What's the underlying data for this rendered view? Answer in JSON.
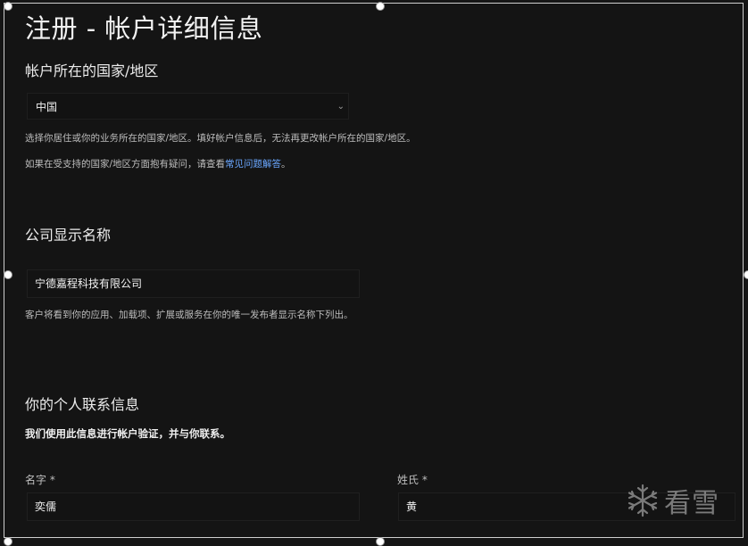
{
  "page": {
    "title": "注册 - 帐户详细信息"
  },
  "country_section": {
    "heading": "帐户所在的国家/地区",
    "selected": "中国",
    "help1": "选择你居住或你的业务所在的国家/地区。填好帐户信息后，无法再更改帐户所在的国家/地区。",
    "help2_prefix": "如果在受支持的国家/地区方面抱有疑问，请查看",
    "help2_link": "常见问题解答",
    "help2_suffix": "。"
  },
  "company_section": {
    "heading": "公司显示名称",
    "value": "宁德嘉程科技有限公司",
    "help": "客户将看到你的应用、加载项、扩展或服务在你的唯一发布者显示名称下列出。"
  },
  "contact_section": {
    "heading": "你的个人联系信息",
    "note": "我们使用此信息进行帐户验证，并与你联系。",
    "first_name_label": "名字 *",
    "first_name_value": "奕儒",
    "last_name_label": "姓氏 *",
    "last_name_value": "黄"
  },
  "watermark": {
    "text": "看雪",
    "icon": "snowflake-icon"
  }
}
